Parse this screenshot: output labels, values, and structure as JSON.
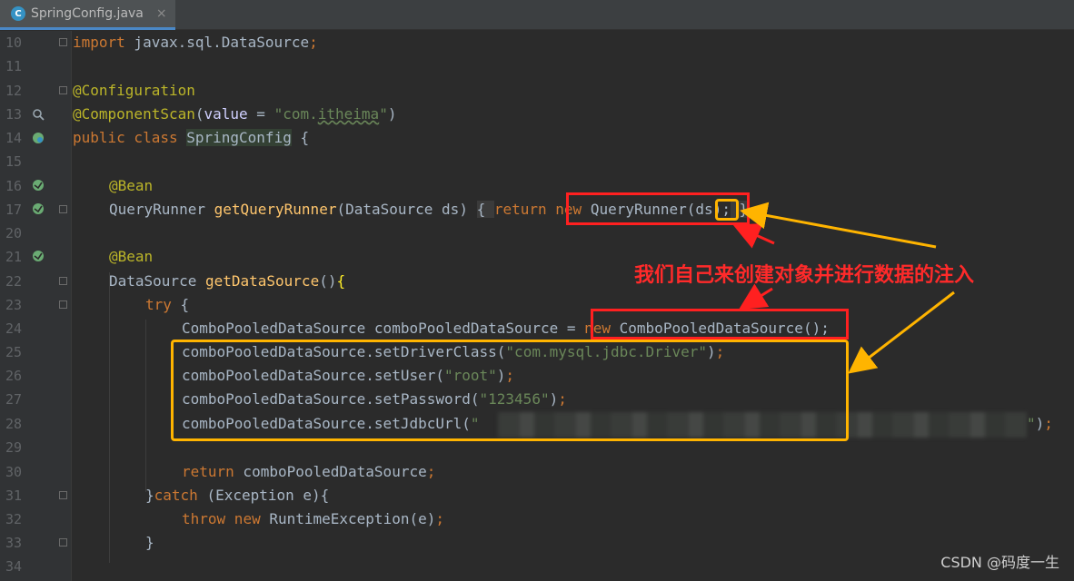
{
  "tab": {
    "title": "SpringConfig.java",
    "icon": "class-icon",
    "icon_letter": "C",
    "close": "×"
  },
  "line_numbers": [
    "10",
    "11",
    "12",
    "13",
    "14",
    "15",
    "16",
    "17",
    "20",
    "21",
    "22",
    "23",
    "24",
    "25",
    "26",
    "27",
    "28",
    "29",
    "30",
    "31",
    "32",
    "33",
    "34"
  ],
  "code": {
    "import_kw": "import",
    "import_path": " javax.sql.DataSource",
    "semicolon": ";",
    "annotation_configuration": "@Configuration",
    "annotation_componentscan": "@ComponentScan",
    "cs_open": "(",
    "cs_value": "value",
    "cs_eq": " = ",
    "cs_str_pre": "\"com.",
    "cs_str_typo": "itheima",
    "cs_str_post": "\"",
    "cs_close": ")",
    "public_kw": "public",
    "class_kw": " class ",
    "class_name": "SpringConfig",
    "brace_open": " {",
    "bean1": "@Bean",
    "qr_type": "QueryRunner ",
    "qr_method": "getQueryRunner",
    "qr_params": "(DataSource ds) ",
    "qr_body_open": "{ ",
    "return_kw": "return",
    "space": " ",
    "new_kw": "new",
    "qr_ctor": " QueryRunner(",
    "ds": "ds",
    "qr_end": ");",
    "qr_body_close": " }",
    "bean2": "@Bean",
    "ds_type": "DataSource ",
    "ds_method": "getDataSource",
    "ds_paren": "()",
    "ds_brace": "{",
    "try_kw": "try",
    "try_brace": " {",
    "cpds_decl": "ComboPooledDataSource comboPooledDataSource = ",
    "cpds_new": "new",
    "cpds_ctor": " ComboPooledDataSource();",
    "set_driver": "comboPooledDataSource.setDriverClass(",
    "driver_str": "\"com.mysql.jdbc.Driver\"",
    "set_user": "comboPooledDataSource.setUser(",
    "user_str": "\"root\"",
    "set_password": "comboPooledDataSource.setPassword(",
    "password_str": "\"123456\"",
    "set_url": "comboPooledDataSource.setJdbcUrl(",
    "url_str_start": "\"",
    "url_str_end": "\"",
    "close_paren": ")",
    "return_kw2": "return",
    "return_val": " comboPooledDataSource",
    "catch_close": "}",
    "catch_kw": "catch",
    "catch_rest": " (Exception e){",
    "throw_kw": "throw",
    "throw_new": " new",
    "throw_rest": " RuntimeException(e)",
    "end_brace": "}"
  },
  "annotation_text": "我们自己来创建对象并进行数据的注入",
  "watermark": "CSDN @码度一生",
  "colors": {
    "keyword": "#cc7832",
    "annotation": "#bbb529",
    "string": "#6a8759",
    "method": "#ffc66d",
    "red_box": "#ff2020",
    "yellow_box": "#ffb400"
  }
}
